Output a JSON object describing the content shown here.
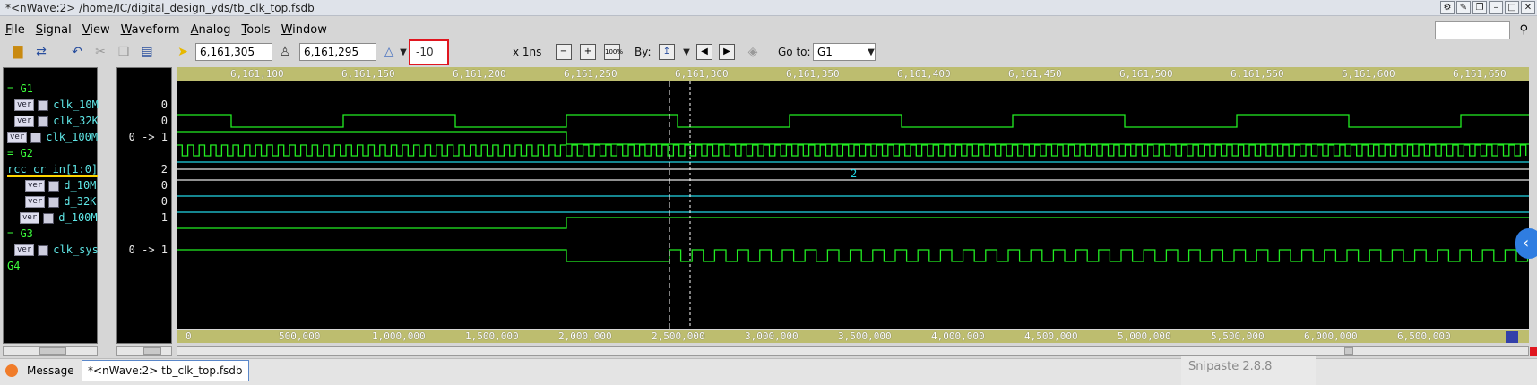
{
  "window": {
    "title": "*<nWave:2> /home/IC/digital_design_yds/tb_clk_top.fsdb"
  },
  "menu": [
    {
      "label": "File",
      "u": "F",
      "rest": "ile"
    },
    {
      "label": "Signal",
      "u": "S",
      "rest": "ignal"
    },
    {
      "label": "View",
      "u": "V",
      "rest": "iew"
    },
    {
      "label": "Waveform",
      "u": "W",
      "rest": "aveform"
    },
    {
      "label": "Analog",
      "u": "A",
      "rest": "nalog"
    },
    {
      "label": "Tools",
      "u": "T",
      "rest": "ools"
    },
    {
      "label": "Window",
      "u": "W",
      "rest": "indow"
    }
  ],
  "toolbar": {
    "cursor_time": "6,161,305",
    "marker_time": "6,161,295",
    "delta": "-10",
    "time_unit": "x 1ns",
    "by_label": "By:",
    "goto_label": "Go to:",
    "goto_value": "G1"
  },
  "ruler_top": [
    "6,161,100",
    "6,161,150",
    "6,161,200",
    "6,161,250",
    "6,161,300",
    "6,161,350",
    "6,161,400",
    "6,161,450",
    "6,161,500",
    "6,161,550",
    "6,161,600",
    "6,161,650"
  ],
  "ruler_bottom": [
    "0",
    "500,000",
    "1,000,000",
    "1,500,000",
    "2,000,000",
    "2,500,000",
    "3,000,000",
    "3,500,000",
    "4,000,000",
    "4,500,000",
    "5,000,000",
    "5,500,000",
    "6,000,000",
    "6,500,000"
  ],
  "signals": [
    {
      "kind": "group",
      "name": "= G1",
      "value": ""
    },
    {
      "kind": "signal",
      "name": "clk_10M",
      "value": "0",
      "badge": "ver"
    },
    {
      "kind": "signal",
      "name": "clk_32K",
      "value": "0",
      "badge": "ver"
    },
    {
      "kind": "signal",
      "name": "clk_100M",
      "value": "0 -> 1",
      "badge": "ver"
    },
    {
      "kind": "group",
      "name": "= G2",
      "value": ""
    },
    {
      "kind": "bus",
      "name": "rcc_cr_in[1:0]",
      "value": "2"
    },
    {
      "kind": "signal",
      "name": "d_10M",
      "value": "0",
      "badge": "ver"
    },
    {
      "kind": "signal",
      "name": "d_32K",
      "value": "0",
      "badge": "ver"
    },
    {
      "kind": "signal",
      "name": "d_100M",
      "value": "1",
      "badge": "ver"
    },
    {
      "kind": "group",
      "name": "= G3",
      "value": ""
    },
    {
      "kind": "signal",
      "name": "clk_sys",
      "value": "0 -> 1",
      "badge": "ver"
    },
    {
      "kind": "group",
      "name": "G4",
      "value": ""
    }
  ],
  "bus_label": "2",
  "colors": {
    "wave_green": "#22ee22",
    "wave_cyan": "#22d6e6",
    "wave_white": "#e6e6e6",
    "ruler": "#bdbd6f",
    "delta_box": "#e0161f"
  },
  "status": {
    "message_tab": "Message",
    "doc_tab": "*<nWave:2> tb_clk_top.fsdb",
    "snipaste": "Snipaste 2.8.8"
  }
}
